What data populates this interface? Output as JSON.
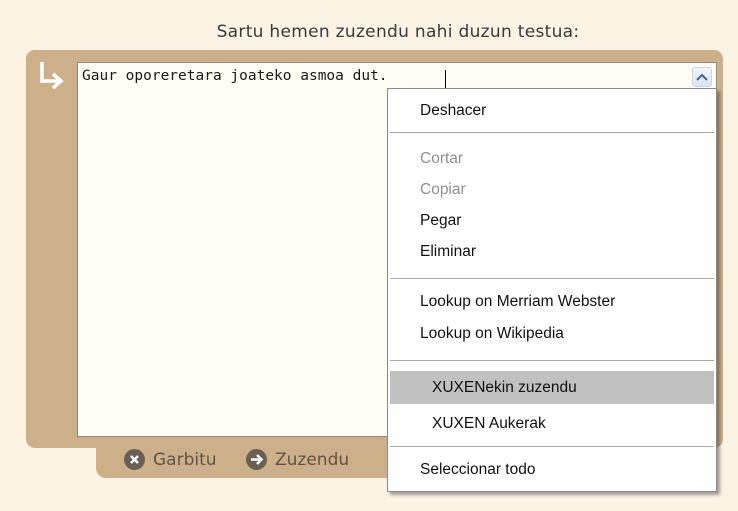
{
  "prompt": "Sartu hemen zuzendu nahi duzun testua:",
  "editor": {
    "text": "Gaur oporeretara joateko asmoa dut."
  },
  "buttons": {
    "clear_label": "Garbitu",
    "correct_label": "Zuzendu"
  },
  "context_menu": {
    "undo": "Deshacer",
    "cut": "Cortar",
    "copy": "Copiar",
    "paste": "Pegar",
    "delete": "Eliminar",
    "lookup_merriam": "Lookup on Merriam Webster",
    "lookup_wikipedia": "Lookup on Wikipedia",
    "xuxen_correct": "XUXENekin zuzendu",
    "xuxen_options": "XUXEN Aukerak",
    "select_all": "Seleccionar todo",
    "highlighted_item": "XUXENekin zuzendu",
    "disabled_items": [
      "Cortar",
      "Copiar"
    ]
  },
  "colors": {
    "background": "#fbf3e4",
    "frame": "#cdb08a",
    "highlight": "#c1c1c1"
  }
}
